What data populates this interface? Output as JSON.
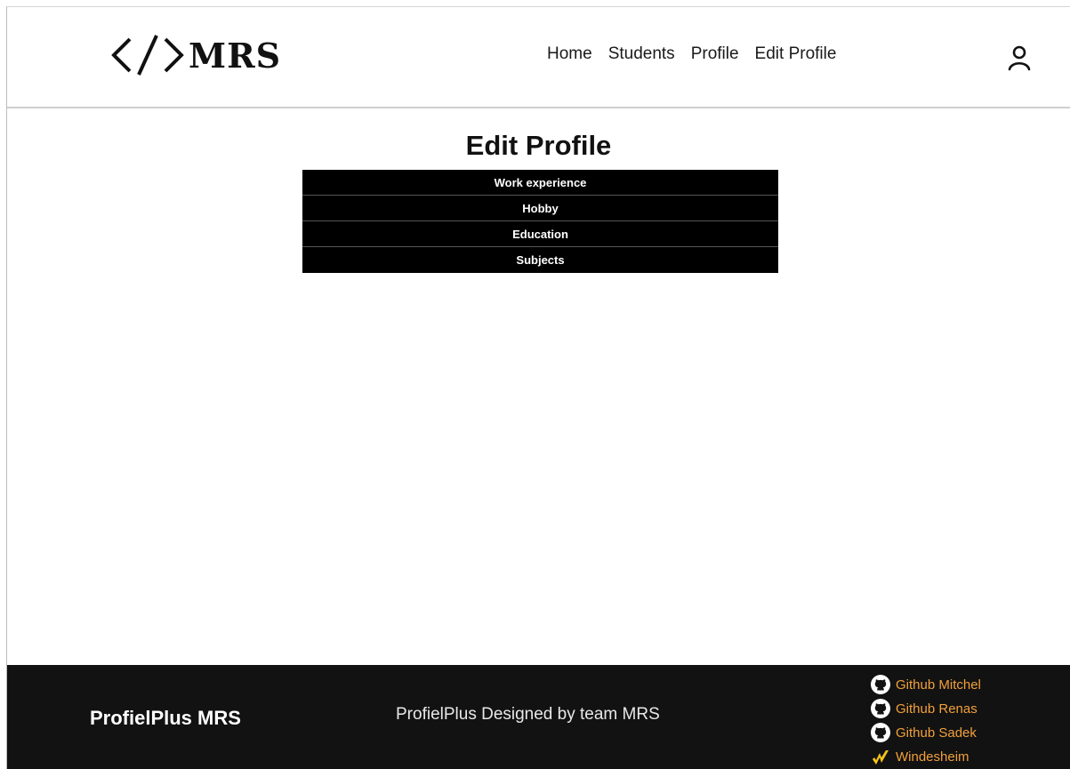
{
  "header": {
    "logo_text": "MRS",
    "nav": [
      "Home",
      "Students",
      "Profile",
      "Edit Profile"
    ],
    "user_icon": "user-icon"
  },
  "main": {
    "title": "Edit Profile",
    "sections": [
      "Work experience",
      "Hobby",
      "Education",
      "Subjects"
    ]
  },
  "footer": {
    "brand": "ProfielPlus MRS",
    "credit": "ProfielPlus Designed by team MRS",
    "links": [
      {
        "label": "Github Mitchel",
        "icon": "github-icon"
      },
      {
        "label": "Github Renas",
        "icon": "github-icon"
      },
      {
        "label": "Github Sadek",
        "icon": "github-icon"
      },
      {
        "label": "Windesheim",
        "icon": "windesheim-icon"
      }
    ]
  },
  "colors": {
    "footer_bg": "#121212",
    "link": "#f2a03a",
    "menu_bg": "#000000"
  }
}
